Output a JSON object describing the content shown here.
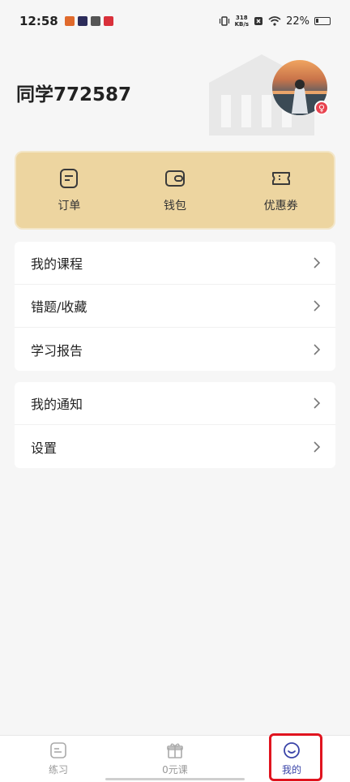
{
  "status_bar": {
    "time": "12:58",
    "net_speed_top": "318",
    "net_speed_bottom": "KB/s",
    "battery": "22%",
    "battery_level": 0.22
  },
  "profile": {
    "username": "同学772587",
    "gender_symbol": "♀"
  },
  "quick_actions": [
    {
      "label": "订单",
      "icon": "order-icon"
    },
    {
      "label": "钱包",
      "icon": "wallet-icon"
    },
    {
      "label": "优惠券",
      "icon": "coupon-icon"
    }
  ],
  "menu_group_1": [
    {
      "label": "我的课程"
    },
    {
      "label": "错题/收藏"
    },
    {
      "label": "学习报告"
    }
  ],
  "menu_group_2": [
    {
      "label": "我的通知"
    },
    {
      "label": "设置"
    }
  ],
  "tabbar": {
    "items": [
      {
        "label": "练习",
        "icon": "practice-icon"
      },
      {
        "label": "0元课",
        "icon": "gift-icon"
      },
      {
        "label": "我的",
        "icon": "profile-smile-icon"
      }
    ],
    "active_index": 2
  },
  "colors": {
    "card": "#edd5a0",
    "active_tab": "#3a44a8",
    "highlight_frame": "#e0141f"
  }
}
